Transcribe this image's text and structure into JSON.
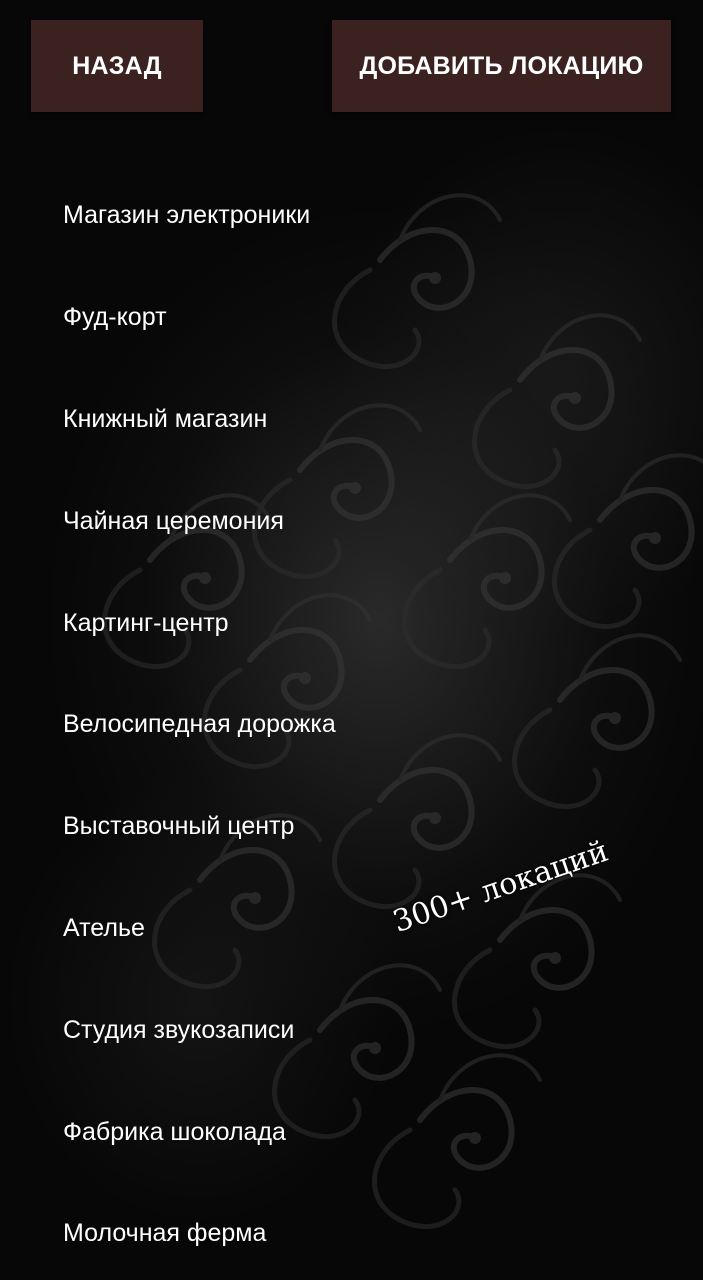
{
  "header": {
    "back_label": "НАЗАД",
    "add_location_label": "ДОБАВИТЬ ЛОКАЦИЮ"
  },
  "locations": [
    "Магазин электроники",
    "Фуд-корт",
    "Книжный магазин",
    "Чайная церемония",
    "Картинг-центр",
    "Велосипедная дорожка",
    "Выставочный центр",
    "Ателье",
    "Студия звукозаписи",
    "Фабрика шоколада",
    "Молочная ферма"
  ],
  "promo_text": "300+ локаций",
  "colors": {
    "button_background": "#3b2220",
    "text": "#ffffff",
    "background": "#070707"
  }
}
